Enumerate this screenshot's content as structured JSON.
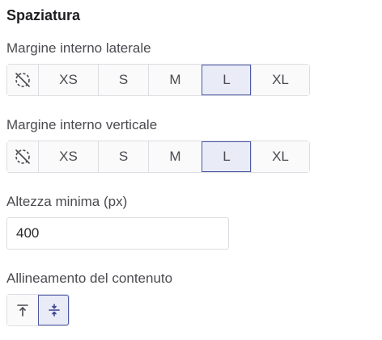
{
  "section": {
    "title": "Spaziatura"
  },
  "horizontal_padding": {
    "label": "Margine interno laterale",
    "options": [
      {
        "icon": "none-icon",
        "label": ""
      },
      {
        "label": "XS"
      },
      {
        "label": "S"
      },
      {
        "label": "M"
      },
      {
        "label": "L"
      },
      {
        "label": "XL"
      }
    ],
    "selected": "L"
  },
  "vertical_padding": {
    "label": "Margine interno verticale",
    "options": [
      {
        "icon": "none-icon",
        "label": ""
      },
      {
        "label": "XS"
      },
      {
        "label": "S"
      },
      {
        "label": "M"
      },
      {
        "label": "L"
      },
      {
        "label": "XL"
      }
    ],
    "selected": "L"
  },
  "min_height": {
    "label": "Altezza minima (px)",
    "value": "400"
  },
  "content_alignment": {
    "label": "Allineamento del contenuto",
    "options": [
      {
        "icon": "align-top-icon"
      },
      {
        "icon": "align-center-icon"
      }
    ],
    "selected": "align-center-icon"
  },
  "colors": {
    "accent_border": "#4d58a6",
    "accent_bg": "#e9ebf7",
    "border": "#dcdde2"
  }
}
